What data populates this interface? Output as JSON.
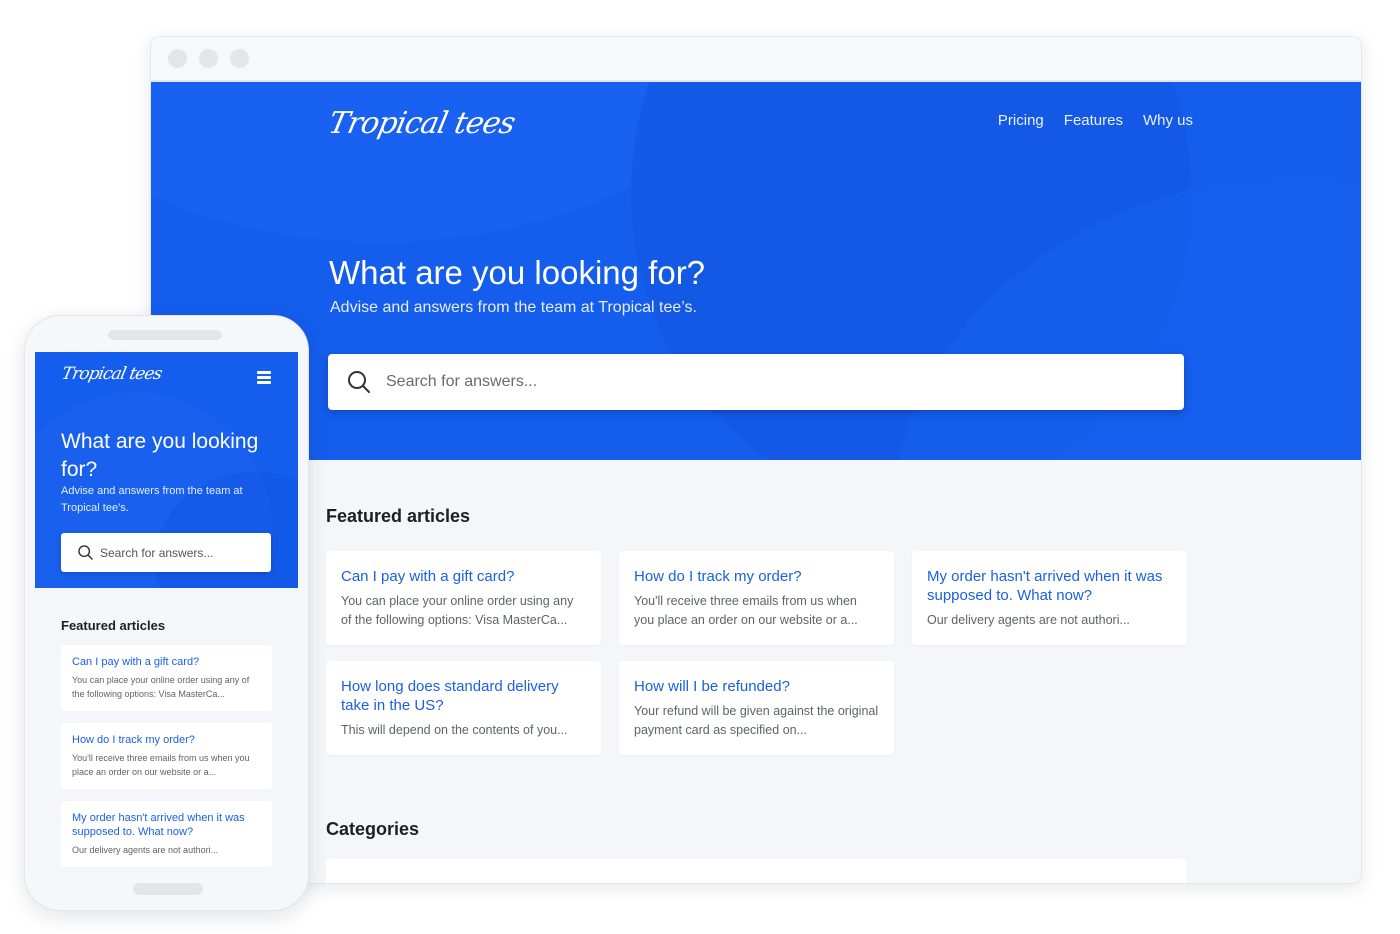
{
  "brand": {
    "name": "Tropical tees",
    "accent_color": "#155ded",
    "link_color": "#1a5fe6"
  },
  "desktop": {
    "nav": [
      {
        "label": "Pricing"
      },
      {
        "label": "Features"
      },
      {
        "label": "Why us"
      }
    ],
    "hero": {
      "title": "What are you looking for?",
      "subtitle": "Advise and answers from the team at Tropical tee’s.",
      "search_placeholder": "Search for answers...",
      "search_icon": "search-icon"
    },
    "featured_title": "Featured articles",
    "articles": [
      {
        "title": "Can I pay with a gift card?",
        "excerpt": "You can place your online order using any of the following options: Visa MasterCa..."
      },
      {
        "title": "How do I track my order?",
        "excerpt": "You'll receive three emails from us when you place an order on our website or a..."
      },
      {
        "title": "My order hasn't arrived when it was supposed to. What now?",
        "excerpt": "Our delivery agents are not authori..."
      },
      {
        "title": "How long does standard delivery take in the US?",
        "excerpt": "This will depend on the contents of you..."
      },
      {
        "title": "How will I be refunded?",
        "excerpt": "Your refund will be given against the original payment card as specified on..."
      }
    ],
    "categories_title": "Categories"
  },
  "mobile": {
    "menu_icon": "hamburger-menu-icon",
    "hero": {
      "title": "What are you looking for?",
      "subtitle": "Advise and answers from the team at Tropical tee’s.",
      "search_placeholder": "Search for answers..."
    },
    "featured_title": "Featured articles",
    "articles": [
      {
        "title": "Can I pay with a gift card?",
        "excerpt": "You can place your online order using any of the following options: Visa MasterCa..."
      },
      {
        "title": "How do I track my order?",
        "excerpt": "You'll receive three emails from us when you place an order on our website or a..."
      },
      {
        "title": "My order hasn't arrived when it was supposed to. What now?",
        "excerpt": "Our delivery agents are not authori..."
      }
    ]
  }
}
